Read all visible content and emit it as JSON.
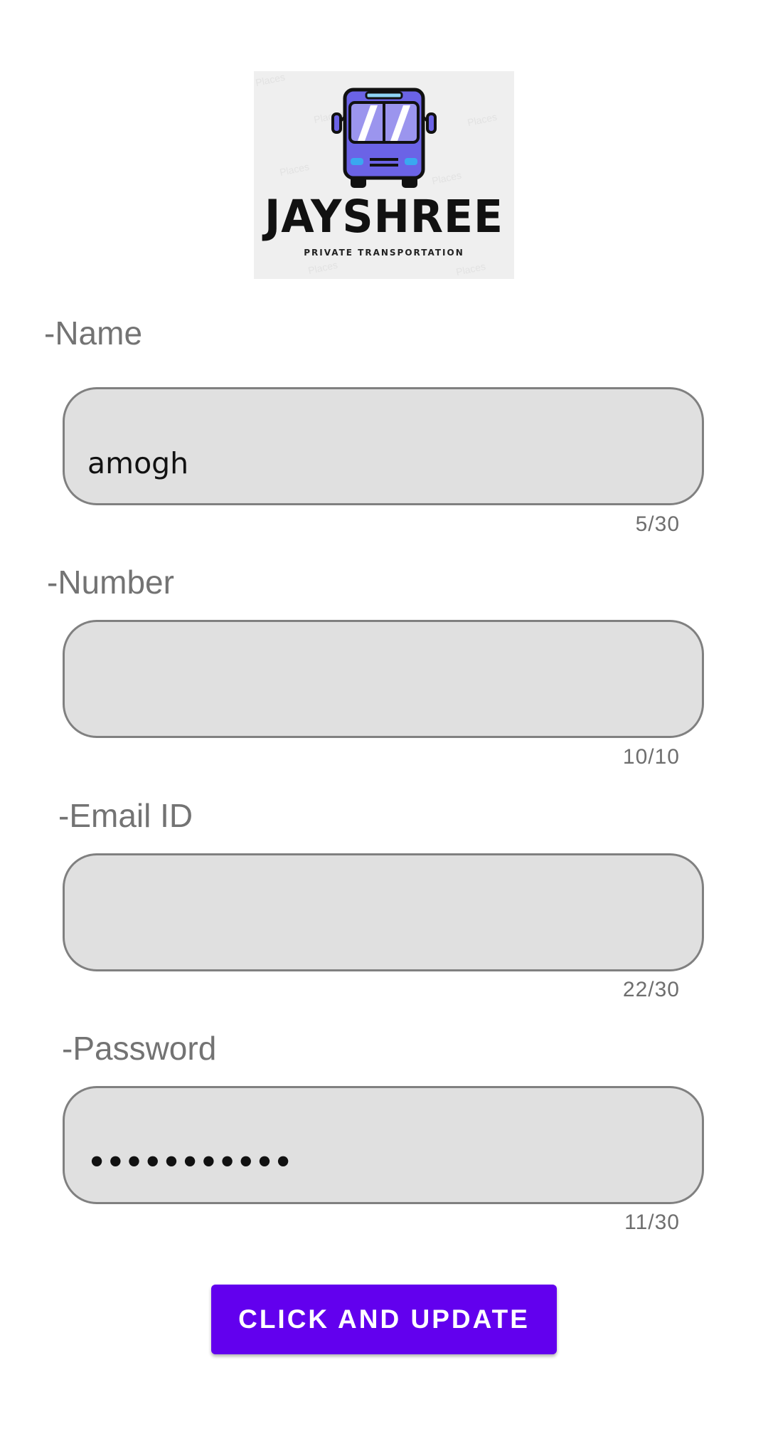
{
  "logo": {
    "brand": "JAYSHREE",
    "tagline": "PRIVATE TRANSPORTATION",
    "watermark": "Places",
    "icon": "bus-icon",
    "bus_color": "#6b63e6"
  },
  "form": {
    "name": {
      "label": "-Name",
      "value": "amogh",
      "counter": "5/30"
    },
    "number": {
      "label": "-Number",
      "value": "",
      "counter": "10/10"
    },
    "email": {
      "label": "-Email ID",
      "value": "",
      "counter": "22/30"
    },
    "password": {
      "label": "-Password",
      "value": "•••••••••••",
      "counter": "11/30"
    }
  },
  "submit": {
    "label": "CLICK AND UPDATE",
    "color": "#6200ee"
  }
}
